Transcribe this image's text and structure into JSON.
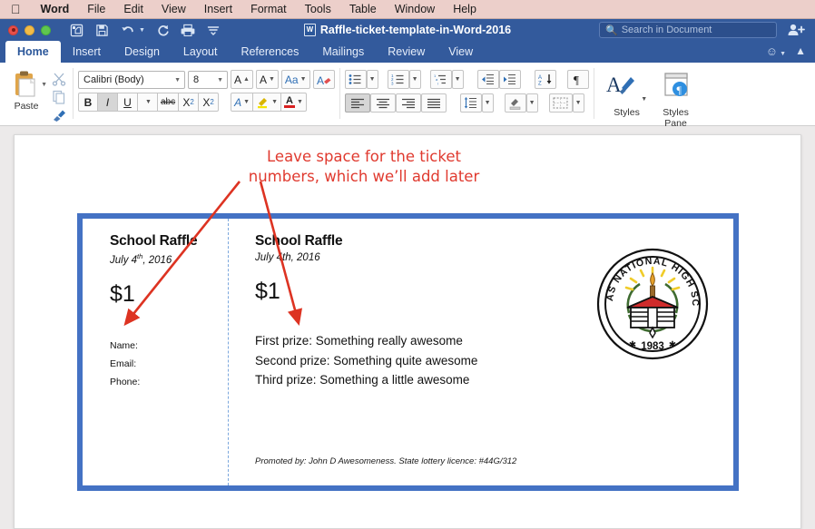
{
  "menubar": {
    "apple_icon": "apple-icon",
    "items": [
      {
        "label": "Word",
        "bold": true
      },
      {
        "label": "File",
        "bold": false
      },
      {
        "label": "Edit",
        "bold": false
      },
      {
        "label": "View",
        "bold": false
      },
      {
        "label": "Insert",
        "bold": false
      },
      {
        "label": "Format",
        "bold": false
      },
      {
        "label": "Tools",
        "bold": false
      },
      {
        "label": "Table",
        "bold": false
      },
      {
        "label": "Window",
        "bold": false
      },
      {
        "label": "Help",
        "bold": false
      }
    ]
  },
  "titlebar": {
    "document_title": "Raffle-ticket-template-in-Word-2016",
    "window_controls": [
      "close",
      "minimize",
      "zoom"
    ],
    "quick_access": [
      {
        "name": "new-document-icon"
      },
      {
        "name": "save-icon"
      },
      {
        "name": "undo-icon"
      },
      {
        "name": "redo-icon"
      },
      {
        "name": "print-icon"
      },
      {
        "name": "customize-toolbar-icon"
      }
    ],
    "search": {
      "placeholder": "Search in Document",
      "icon": "search-icon"
    },
    "share_icon": "share-person-icon"
  },
  "ribbon": {
    "tabs": [
      {
        "label": "Home",
        "active": true
      },
      {
        "label": "Insert",
        "active": false
      },
      {
        "label": "Design",
        "active": false
      },
      {
        "label": "Layout",
        "active": false
      },
      {
        "label": "References",
        "active": false
      },
      {
        "label": "Mailings",
        "active": false
      },
      {
        "label": "Review",
        "active": false
      },
      {
        "label": "View",
        "active": false
      }
    ],
    "smiley_icon": "smiley-face-icon",
    "collapse_icon": "chevron-up-icon",
    "clipboard": {
      "paste_label": "Paste",
      "paste_icon": "clipboard-paste-icon",
      "cut_icon": "scissors-icon",
      "copy_icon": "copy-icon",
      "format_painter_icon": "format-painter-icon"
    },
    "font": {
      "font_name": "Calibri (Body)",
      "font_size": "8",
      "grow_font_label": "A",
      "shrink_font_label": "A",
      "change_case_label": "Aa",
      "clear_formatting_icon": "clear-formatting-icon",
      "bold_label": "B",
      "italic_label": "I",
      "underline_label": "U",
      "strikethrough_label": "abc",
      "subscript_label": "X",
      "superscript_label": "X",
      "text_effects_label": "A",
      "highlight_label": "highlight-icon",
      "font_color_label": "A",
      "italic_active": true
    },
    "paragraph": {
      "bullets_icon": "bullet-list-icon",
      "numbering_icon": "numbered-list-icon",
      "multilevel_icon": "multilevel-list-icon",
      "decrease_indent_icon": "decrease-indent-icon",
      "increase_indent_icon": "increase-indent-icon",
      "sort_icon": "sort-az-icon",
      "show_marks_icon": "pilcrow-icon",
      "align_left_icon": "align-left-icon",
      "align_center_icon": "align-center-icon",
      "align_right_icon": "align-right-icon",
      "justify_icon": "justify-icon",
      "line_spacing_icon": "line-spacing-icon",
      "shading_icon": "shading-icon",
      "borders_icon": "borders-icon",
      "align_left_active": true
    },
    "styles": {
      "styles_label": "Styles",
      "styles_icon": "styles-brush-icon",
      "styles_pane_label_line1": "Styles",
      "styles_pane_label_line2": "Pane",
      "styles_pane_icon": "styles-pane-icon"
    }
  },
  "document": {
    "annotation": {
      "line1": "Leave space for the ticket",
      "line2": "numbers, which we’ll add later",
      "color": "#e03a2f"
    },
    "ticket": {
      "border_color": "#4472c4",
      "stub": {
        "title": "School Raffle",
        "date_prefix": "July 4",
        "date_superscript": "th",
        "date_suffix": ", 2016",
        "price": "$1",
        "fields": [
          "Name:",
          "Email:",
          "Phone:"
        ]
      },
      "main": {
        "title": "School Raffle",
        "date": "July 4th, 2016",
        "price": "$1",
        "prizes": [
          "First prize: Something really awesome",
          "Second prize: Something quite awesome",
          "Third prize: Something a little awesome"
        ],
        "footer": "Promoted by: John D Awesomeness. State lottery licence: #44G/312"
      },
      "seal": {
        "name": "school-seal-logo",
        "text": "NAVOTAS NATIONAL HIGH SCHOOL",
        "year": "1983"
      }
    }
  }
}
